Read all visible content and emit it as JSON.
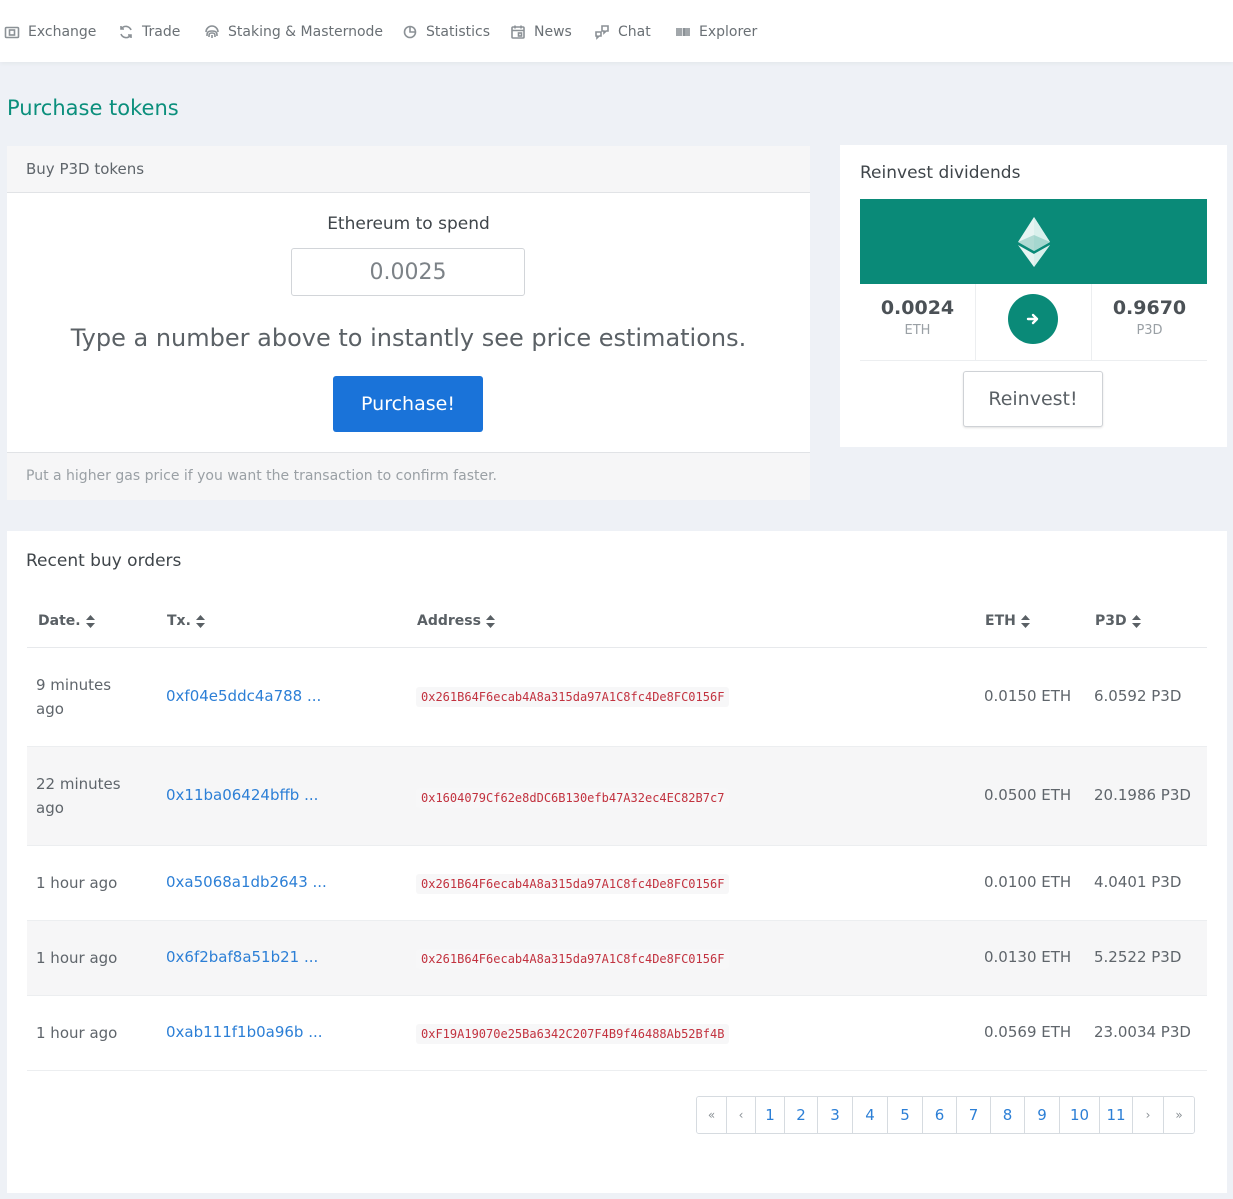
{
  "nav": {
    "items": [
      {
        "label": "Exchange",
        "icon": "wallet-icon"
      },
      {
        "label": "Trade",
        "icon": "refresh-icon"
      },
      {
        "label": "Staking & Masternode",
        "icon": "fingerprint-icon"
      },
      {
        "label": "Statistics",
        "icon": "pie-chart-icon"
      },
      {
        "label": "News",
        "icon": "calendar-icon"
      },
      {
        "label": "Chat",
        "icon": "chat-icon"
      },
      {
        "label": "Explorer",
        "icon": "barcode-icon"
      }
    ]
  },
  "page": {
    "title": "Purchase tokens"
  },
  "buy": {
    "header": "Buy P3D tokens",
    "eth_label": "Ethereum to spend",
    "eth_value": "0.0025",
    "hint": "Type a number above to instantly see price estimations.",
    "purchase_label": "Purchase!",
    "footer": "Put a higher gas price if you want the transaction to confirm faster."
  },
  "reinvest": {
    "title": "Reinvest dividends",
    "eth_value": "0.0024",
    "eth_unit": "ETH",
    "p3d_value": "0.9670",
    "p3d_unit": "P3D",
    "button_label": "Reinvest!",
    "banner_icon": "ethereum-icon",
    "arrow_icon": "arrow-right-icon"
  },
  "orders": {
    "title": "Recent buy orders",
    "columns": {
      "date": "Date.",
      "tx": "Tx.",
      "address": "Address",
      "eth": "ETH",
      "p3d": "P3D"
    },
    "rows": [
      {
        "date": "9 minutes ago",
        "tx": "0xf04e5ddc4a788 ...",
        "address": "0x261B64F6ecab4A8a315da97A1C8fc4De8FC0156F",
        "eth": "0.0150 ETH",
        "p3d": "6.0592 P3D"
      },
      {
        "date": "22 minutes ago",
        "tx": "0x11ba06424bffb ...",
        "address": "0x1604079Cf62e8dDC6B130efb47A32ec4EC82B7c7",
        "eth": "0.0500 ETH",
        "p3d": "20.1986 P3D"
      },
      {
        "date": "1 hour ago",
        "tx": "0xa5068a1db2643 ...",
        "address": "0x261B64F6ecab4A8a315da97A1C8fc4De8FC0156F",
        "eth": "0.0100 ETH",
        "p3d": "4.0401 P3D"
      },
      {
        "date": "1 hour ago",
        "tx": "0x6f2baf8a51b21 ...",
        "address": "0x261B64F6ecab4A8a315da97A1C8fc4De8FC0156F",
        "eth": "0.0130 ETH",
        "p3d": "5.2522 P3D"
      },
      {
        "date": "1 hour ago",
        "tx": "0xab111f1b0a96b ...",
        "address": "0xF19A19070e25Ba6342C207F4B9f46488Ab52Bf4B",
        "eth": "0.0569 ETH",
        "p3d": "23.0034 P3D"
      }
    ]
  },
  "pagination": {
    "first": "«",
    "prev": "‹",
    "pages": [
      "1",
      "2",
      "3",
      "4",
      "5",
      "6",
      "7",
      "8",
      "9",
      "10",
      "11"
    ],
    "next": "›",
    "last": "»"
  },
  "colors": {
    "brand": "#0a8a78",
    "primary": "#1a73d9",
    "link": "#2c7fd6",
    "code": "#c2323f"
  }
}
